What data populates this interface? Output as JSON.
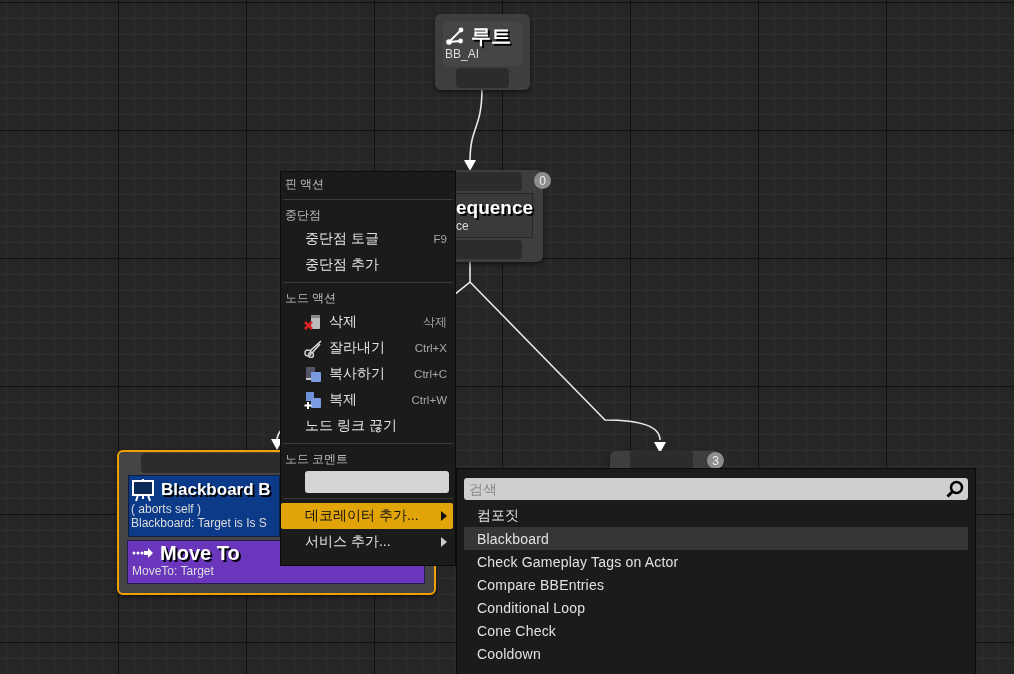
{
  "root_node": {
    "title": "루트",
    "subtitle": "BB_AI"
  },
  "sequence_node": {
    "title": "equence",
    "subtitle": "ce",
    "badge": "0"
  },
  "selected_node": {
    "selected": true,
    "decorator": {
      "title": "Blackboard B",
      "lines": [
        "( aborts self )",
        "Blackboard: Target is Is S"
      ]
    },
    "task": {
      "title": "Move To",
      "subtitle": "MoveTo: Target"
    }
  },
  "right_node": {
    "badge": "3"
  },
  "context_menu": {
    "items": [
      {
        "kind": "header",
        "label": "핀 액션"
      },
      {
        "kind": "separator"
      },
      {
        "kind": "header",
        "label": "중단점"
      },
      {
        "kind": "item",
        "label": "중단점 토글",
        "shortcut": "F9",
        "selected": false
      },
      {
        "kind": "item",
        "label": "중단점 추가",
        "selected": false
      },
      {
        "kind": "separator"
      },
      {
        "kind": "header",
        "label": "노드 액션"
      },
      {
        "kind": "icon_item",
        "label": "삭제",
        "shortcut": "삭제",
        "selected": false
      },
      {
        "kind": "icon_item",
        "label": "잘라내기",
        "shortcut": "Ctrl+X",
        "selected": false
      },
      {
        "kind": "icon_item",
        "label": "복사하기",
        "shortcut": "Ctrl+C",
        "selected": false
      },
      {
        "kind": "icon_item",
        "label": "복제",
        "shortcut": "Ctrl+W",
        "selected": false
      },
      {
        "kind": "item",
        "label": "노드 링크 끊기",
        "selected": false
      },
      {
        "kind": "separator"
      },
      {
        "kind": "header",
        "label": "노드 코멘트"
      },
      {
        "kind": "field"
      },
      {
        "kind": "separator"
      },
      {
        "kind": "submenu",
        "label": "데코레이터 추가...",
        "selected": true
      },
      {
        "kind": "submenu",
        "label": "서비스 추가...",
        "selected": false
      }
    ]
  },
  "submenu": {
    "search": {
      "placeholder": "검색"
    },
    "items": [
      {
        "label": "컴포짓",
        "selected": false
      },
      {
        "label": "Blackboard",
        "selected": true
      },
      {
        "label": "Check Gameplay Tags on Actor",
        "selected": false
      },
      {
        "label": "Compare BBEntries",
        "selected": false
      },
      {
        "label": "Conditional Loop",
        "selected": false
      },
      {
        "label": "Cone Check",
        "selected": false
      },
      {
        "label": "Cooldown",
        "selected": false
      }
    ]
  }
}
